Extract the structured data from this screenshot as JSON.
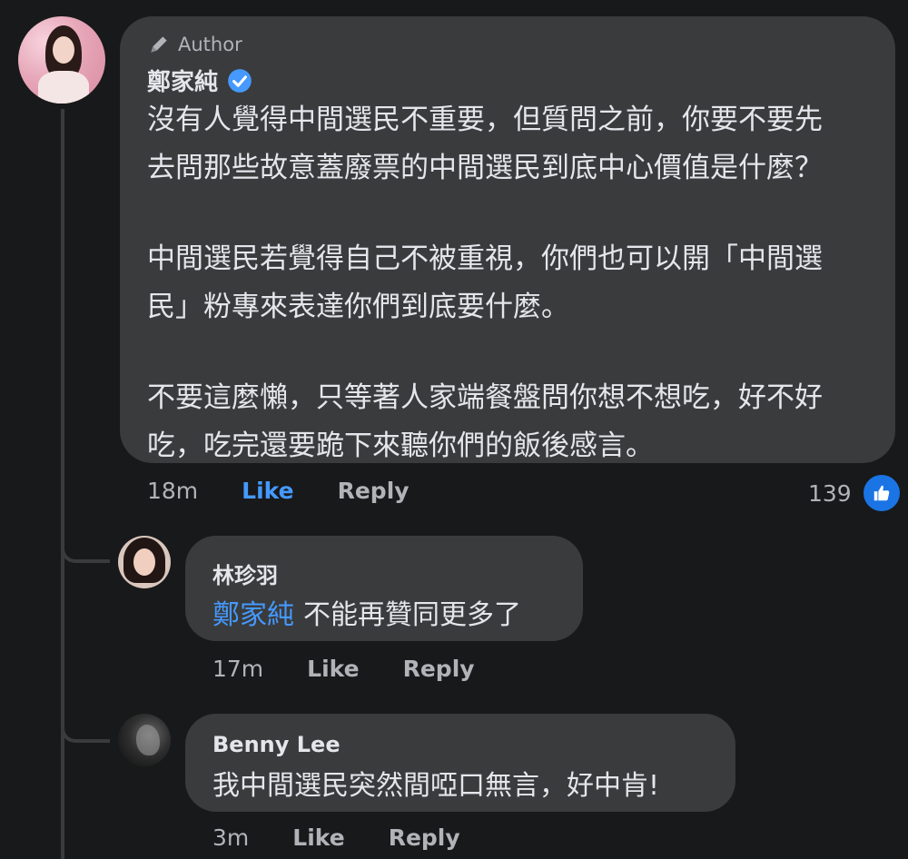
{
  "post_comment": {
    "author_tag": "Author",
    "name": "鄭家純",
    "paragraphs": [
      "沒有人覺得中間選民不重要，但質問之前，你要不要先\n去問那些故意蓋廢票的中間選民到底中心價值是什麼？",
      "中間選民若覺得自己不被重視，你們也可以開「中間選\n民」粉專來表達你們到底要什麼。",
      "不要這麼懶，只等著人家端餐盤問你想不想吃，好不好\n吃，吃完還要跪下來聽你們的飯後感言。"
    ],
    "time": "18m",
    "like_label": "Like",
    "reply_label": "Reply",
    "reaction_count": "139",
    "accent_color": "#4599ff"
  },
  "replies": [
    {
      "name": "林珍羽",
      "mention": "鄭家純",
      "text": "不能再贊同更多了",
      "time": "17m",
      "like_label": "Like",
      "reply_label": "Reply"
    },
    {
      "name": "Benny Lee",
      "text": "我中間選民突然間啞口無言，好中肯!",
      "time": "3m",
      "like_label": "Like",
      "reply_label": "Reply"
    }
  ],
  "icons": {
    "author": "pencil-icon",
    "verified": "verified-badge-icon",
    "reaction": "thumbs-up-icon"
  }
}
